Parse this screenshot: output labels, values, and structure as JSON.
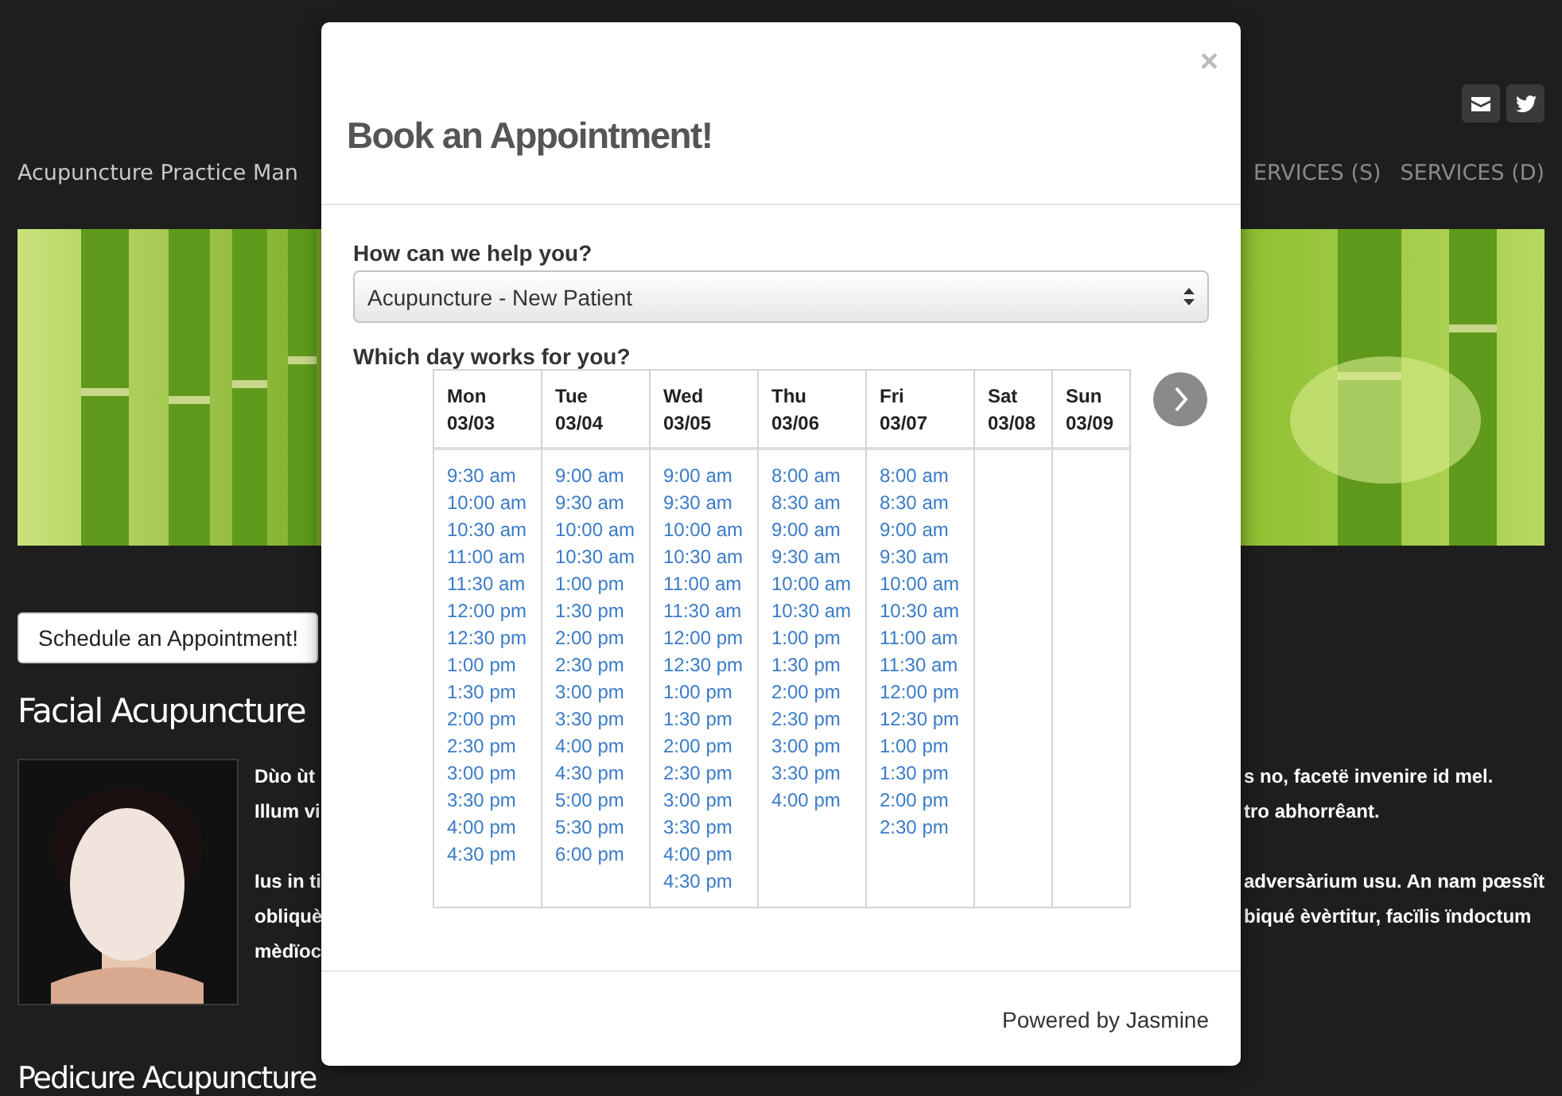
{
  "header": {
    "social_links": [
      {
        "kind": "email"
      },
      {
        "kind": "twitter"
      }
    ]
  },
  "nav": {
    "brand": "Acupuncture Practice Man",
    "items": [
      {
        "label": "ERVICES (S)"
      },
      {
        "label": "SERVICES (D)"
      }
    ]
  },
  "schedule_button": "Schedule an Appointment!",
  "section": {
    "heading": "Facial Acupuncture",
    "paragraphs": [
      {
        "left": [
          "Dùo ùt",
          "Illum vi"
        ],
        "right": [
          "s no, facetë invenire id mel.",
          "tro abhorrêant."
        ]
      },
      {
        "left": [
          "Ius in ti",
          "obliquè",
          "mèdïoc"
        ],
        "right": [
          "adversàrium usu. An nam pœssît",
          "biqué èvèrtitur, facïlis ïndoctum"
        ]
      }
    ]
  },
  "next_heading": "Pedicure Acupuncture",
  "modal": {
    "close": "×",
    "title": "Book an Appointment!",
    "service_label": "How can we help you?",
    "service_select": {
      "value": "Acupuncture - New Patient"
    },
    "day_label": "Which day works for you?",
    "days": [
      {
        "day": "Mon",
        "date": "03/03",
        "slots": [
          "9:30 am",
          "10:00 am",
          "10:30 am",
          "11:00 am",
          "11:30 am",
          "12:00 pm",
          "12:30 pm",
          "1:00 pm",
          "1:30 pm",
          "2:00 pm",
          "2:30 pm",
          "3:00 pm",
          "3:30 pm",
          "4:00 pm",
          "4:30 pm"
        ]
      },
      {
        "day": "Tue",
        "date": "03/04",
        "slots": [
          "9:00 am",
          "9:30 am",
          "10:00 am",
          "10:30 am",
          "1:00 pm",
          "1:30 pm",
          "2:00 pm",
          "2:30 pm",
          "3:00 pm",
          "3:30 pm",
          "4:00 pm",
          "4:30 pm",
          "5:00 pm",
          "5:30 pm",
          "6:00 pm"
        ]
      },
      {
        "day": "Wed",
        "date": "03/05",
        "slots": [
          "9:00 am",
          "9:30 am",
          "10:00 am",
          "10:30 am",
          "11:00 am",
          "11:30 am",
          "12:00 pm",
          "12:30 pm",
          "1:00 pm",
          "1:30 pm",
          "2:00 pm",
          "2:30 pm",
          "3:00 pm",
          "3:30 pm",
          "4:00 pm",
          "4:30 pm"
        ]
      },
      {
        "day": "Thu",
        "date": "03/06",
        "slots": [
          "8:00 am",
          "8:30 am",
          "9:00 am",
          "9:30 am",
          "10:00 am",
          "10:30 am",
          "1:00 pm",
          "1:30 pm",
          "2:00 pm",
          "2:30 pm",
          "3:00 pm",
          "3:30 pm",
          "4:00 pm"
        ]
      },
      {
        "day": "Fri",
        "date": "03/07",
        "slots": [
          "8:00 am",
          "8:30 am",
          "9:00 am",
          "9:30 am",
          "10:00 am",
          "10:30 am",
          "11:00 am",
          "11:30 am",
          "12:00 pm",
          "12:30 pm",
          "1:00 pm",
          "1:30 pm",
          "2:00 pm",
          "2:30 pm"
        ]
      },
      {
        "day": "Sat",
        "date": "03/08"
      },
      {
        "day": "Sun",
        "date": "03/09"
      }
    ],
    "footer": "Powered by Jasmine"
  }
}
